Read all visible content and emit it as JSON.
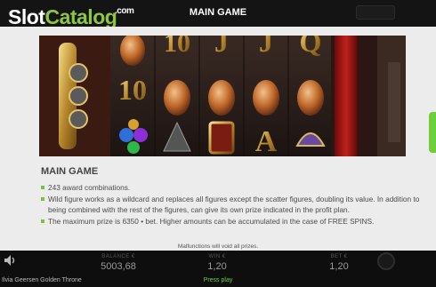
{
  "header": {
    "logo_main": "Slot",
    "logo_accent": "Catalog",
    "logo_tld": ".com",
    "title": "MAIN GAME"
  },
  "image": {
    "description_icons": [
      "dragon-egg-icon",
      "letter-j-icon",
      "letter-q-icon",
      "letter-a-icon",
      "knight-wild-icon",
      "throne-icon",
      "gem-symbol-icon"
    ],
    "reel_letters": [
      "10",
      "J",
      "J",
      "Q",
      "10",
      "A"
    ]
  },
  "section": {
    "title": "MAIN GAME",
    "rules": [
      "243 award combinations.",
      "Wild figure works as a wildcard and replaces all figures except the scatter figures, doubling its value. In addition to being combined with the rest of the figures, can give its own prize indicated in the profit plan.",
      "The maximum prize is 6350 • bet. Higher amounts can be accumulated in the case of FREE SPINS."
    ],
    "footnote": "Malfunctions will void all prizes."
  },
  "bottom": {
    "credits_label": "BALANCE €",
    "credits_value": "5003,68",
    "win_label": "WIN €",
    "win_value": "1,20",
    "bet_label": "BET €",
    "bet_value": "1,20",
    "game_name": "Ilvia Geersen Golden Throne",
    "press_play": "Press play"
  },
  "colors": {
    "accent_green": "#8dc63f",
    "panel_bg": "#ececec",
    "topbar_bg": "#141414"
  }
}
